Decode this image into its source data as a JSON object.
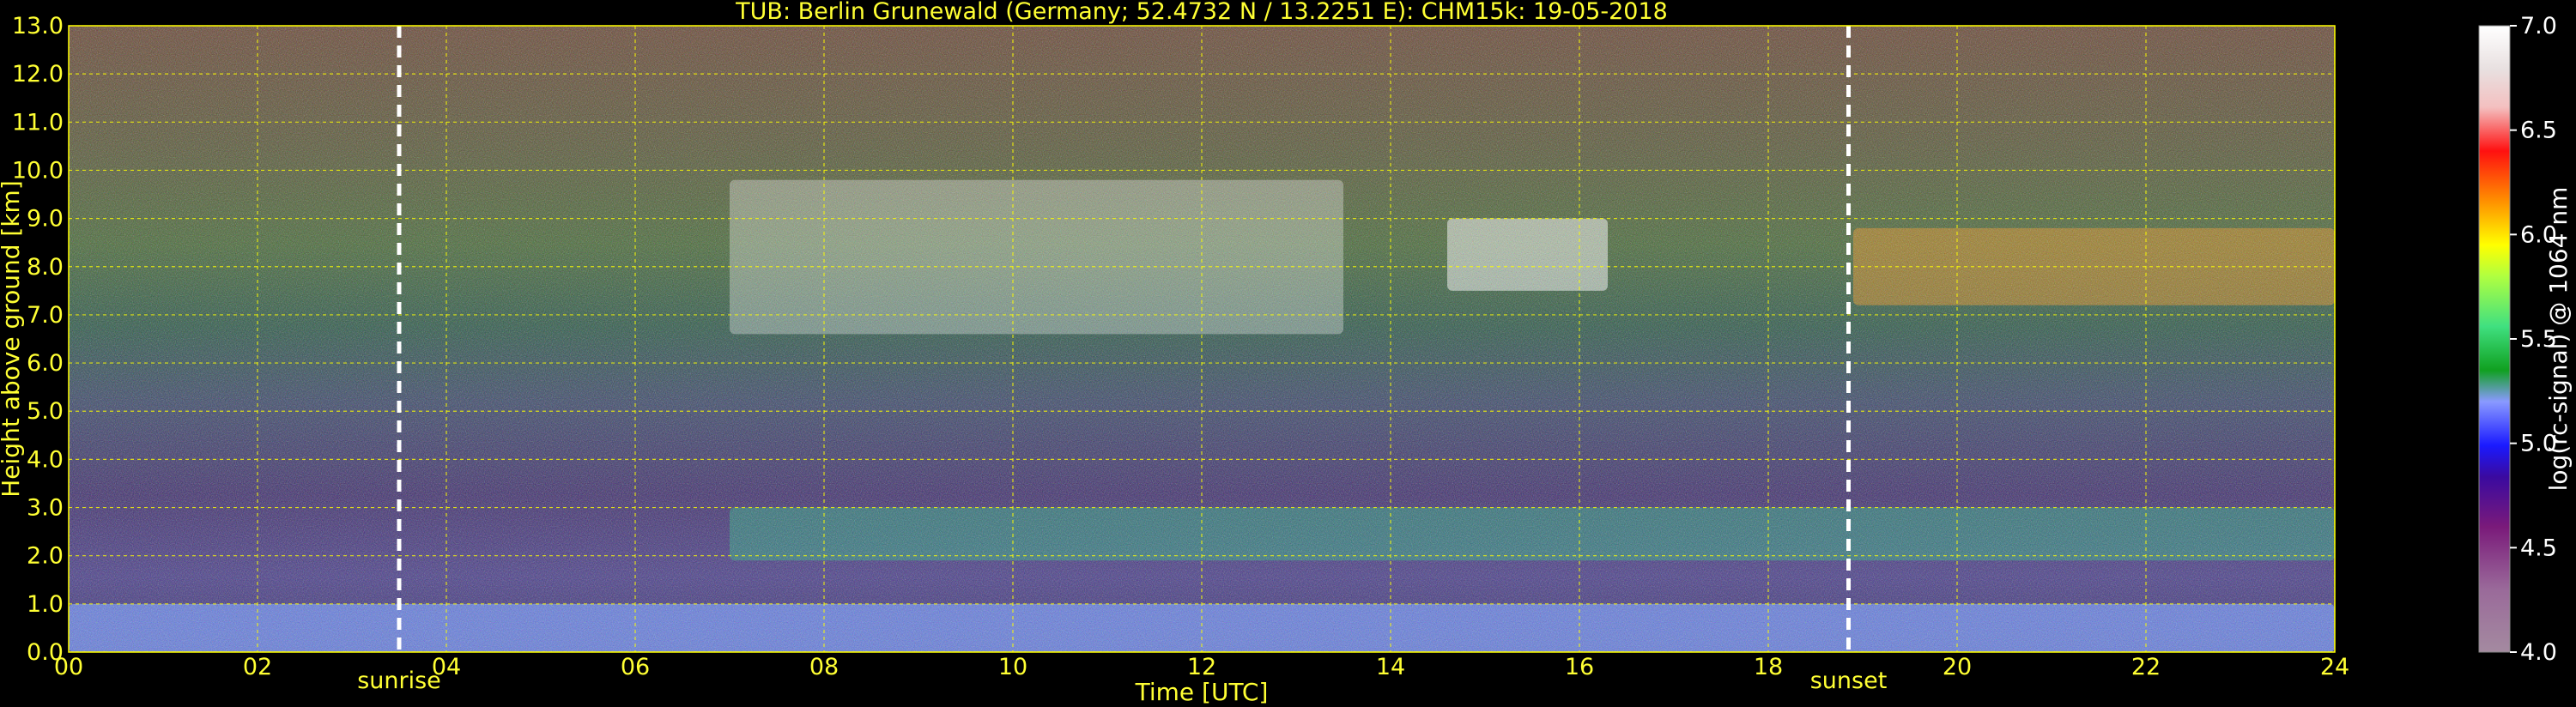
{
  "chart_data": {
    "type": "heatmap",
    "title": "TUB: Berlin Grunewald (Germany; 52.4732 N / 13.2251 E):    CHM15k: 19-05-2018",
    "xlabel": "Time [UTC]",
    "ylabel": "Height above ground [km]",
    "xlim": [
      0,
      24
    ],
    "ylim": [
      0,
      13
    ],
    "x_ticks": [
      "00",
      "02",
      "04",
      "06",
      "08",
      "10",
      "12",
      "14",
      "16",
      "18",
      "20",
      "22",
      "24"
    ],
    "y_ticks": [
      "0.0",
      "1.0",
      "2.0",
      "3.0",
      "4.0",
      "5.0",
      "6.0",
      "7.0",
      "8.0",
      "9.0",
      "10.0",
      "11.0",
      "12.0",
      "13.0"
    ],
    "grid": true,
    "grid_color": "#ffff00",
    "annotations": [
      {
        "label": "sunrise",
        "x": 3.5
      },
      {
        "label": "sunset",
        "x": 18.85
      }
    ],
    "colorbar": {
      "label": "log(rc-signal) @ 1064 nm",
      "min": 4.0,
      "max": 7.0,
      "ticks": [
        "4.0",
        "4.5",
        "5.0",
        "5.5",
        "6.0",
        "6.5",
        "7.0"
      ]
    },
    "features": [
      {
        "name": "mixing-layer",
        "x": [
          0,
          24
        ],
        "y": [
          0,
          1.0
        ]
      },
      {
        "name": "residual-layer",
        "x": [
          7,
          24
        ],
        "y": [
          1.9,
          3.0
        ]
      },
      {
        "name": "cirrus-1",
        "x": [
          7,
          13.5
        ],
        "y": [
          6.6,
          9.8
        ]
      },
      {
        "name": "cirrus-2",
        "x": [
          14.6,
          16.3
        ],
        "y": [
          7.5,
          9.0
        ]
      },
      {
        "name": "cirrus-3",
        "x": [
          18.9,
          24
        ],
        "y": [
          7.2,
          8.8
        ]
      }
    ]
  }
}
